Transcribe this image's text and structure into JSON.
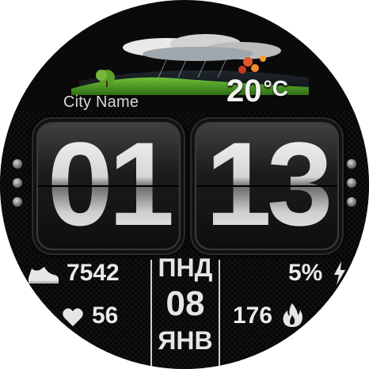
{
  "weather": {
    "city": "City Name",
    "temperature": "20",
    "unit": "°C"
  },
  "time": {
    "hours": "01",
    "minutes": "13"
  },
  "stats": {
    "steps": "7542",
    "heart_rate": "56",
    "battery": "5%",
    "calories": "176"
  },
  "date": {
    "weekday": "ПНД",
    "day": "08",
    "month": "ЯНВ"
  },
  "colors": {
    "background": "#0a0a0a",
    "text": "#eaeaea",
    "tile": "#1c1c1c"
  },
  "icons": [
    "weather-scene-icon",
    "sneaker-icon",
    "heart-icon",
    "lightning-icon",
    "flame-icon"
  ]
}
